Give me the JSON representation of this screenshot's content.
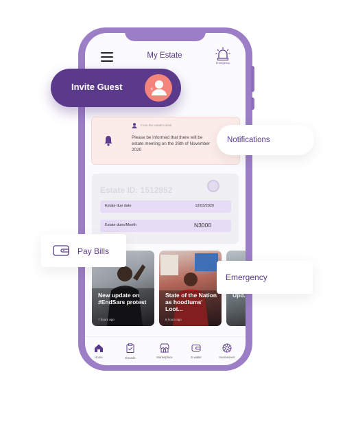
{
  "app": {
    "title": "My Estate",
    "emergency_label": "Emergency"
  },
  "invite": {
    "label": "Invite Guest"
  },
  "notification": {
    "from": "From the estate's desk",
    "message": "Please be informed that there will be estate meeting on the 26th of November 2020"
  },
  "estate": {
    "id_label": "Estate ID: 1512852",
    "rows": [
      {
        "label": "Estate due date",
        "value": "12/03/2020"
      },
      {
        "label": "Estate dues/Month",
        "value": "N3000"
      }
    ]
  },
  "floating": {
    "notifications": "Notifications",
    "pay_bills": "Pay Bills",
    "emergency": "Emergency"
  },
  "news": [
    {
      "title": "New update on #EndSars protest",
      "time": "7 hours ago"
    },
    {
      "title": "State of the Nation as hoodlums' Loot...",
      "time": "6 hours ago"
    },
    {
      "title": "Upd... rece... mai...",
      "time": ""
    }
  ],
  "nav": [
    {
      "label": "Home",
      "icon": "home-icon"
    },
    {
      "label": "Errands",
      "icon": "clipboard-icon"
    },
    {
      "label": "Marketplace",
      "icon": "store-icon"
    },
    {
      "label": "E-wallet",
      "icon": "wallet-icon"
    },
    {
      "label": "Involvement",
      "icon": "aperture-icon"
    }
  ],
  "colors": {
    "primary": "#5b3a8c",
    "phone": "#9b7ec6",
    "accent": "#f5857c",
    "notif_bg": "#fcece9",
    "row_bg": "#e6dcf6"
  }
}
